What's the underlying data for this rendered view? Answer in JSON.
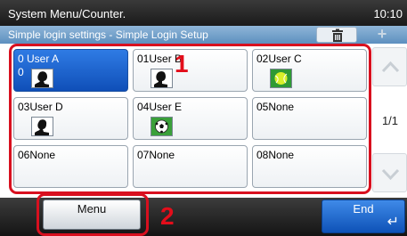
{
  "header": {
    "title": "System Menu/Counter.",
    "time": "10:10",
    "subtitle": "Simple login settings - Simple Login Setup",
    "trash_icon": "trash-icon",
    "add_icon": "plus-icon"
  },
  "tiles": [
    {
      "label": "0 User A",
      "extra": "0",
      "avatar": "silhouette-left",
      "selected": true
    },
    {
      "label": "01User B",
      "extra": "",
      "avatar": "silhouette-left",
      "selected": false
    },
    {
      "label": "02User C",
      "extra": "",
      "avatar": "tennis-ball",
      "selected": false
    },
    {
      "label": "03User D",
      "extra": "",
      "avatar": "silhouette-left",
      "selected": false
    },
    {
      "label": "04User E",
      "extra": "",
      "avatar": "soccer-ball",
      "selected": false
    },
    {
      "label": "05None",
      "extra": "",
      "avatar": "",
      "selected": false
    },
    {
      "label": "06None",
      "extra": "",
      "avatar": "",
      "selected": false
    },
    {
      "label": "07None",
      "extra": "",
      "avatar": "",
      "selected": false
    },
    {
      "label": "08None",
      "extra": "",
      "avatar": "",
      "selected": false
    }
  ],
  "pagination": {
    "text": "1/1"
  },
  "callouts": {
    "one": "1",
    "two": "2"
  },
  "footer": {
    "menu_label": "Menu",
    "end_label": "End",
    "enter_icon": "↵"
  },
  "colors": {
    "accent_blue": "#1f6ad6",
    "callout_red": "#e30d1a",
    "header_dark": "#222222"
  }
}
